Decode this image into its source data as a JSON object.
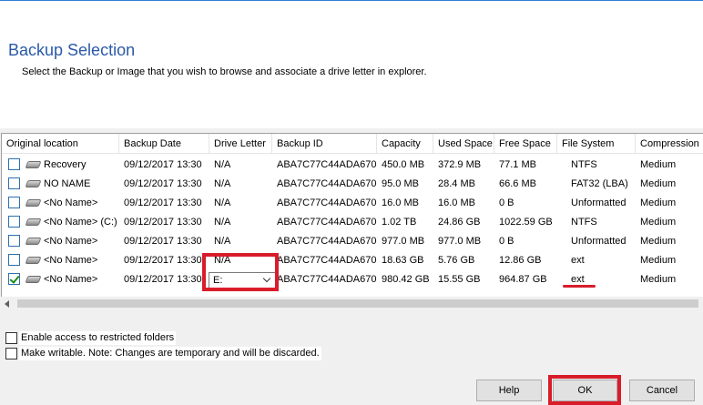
{
  "page": {
    "title": "Backup Selection",
    "subtitle": "Select the Backup or Image that you wish to browse and associate a drive letter in explorer."
  },
  "table": {
    "columns": [
      "Original location",
      "Backup Date",
      "Drive Letter",
      "Backup ID",
      "Capacity",
      "Used Space",
      "Free Space",
      "File System",
      "Compression"
    ],
    "rows": [
      {
        "checked": false,
        "location": "Recovery",
        "date": "09/12/2017 13:30",
        "drive": "N/A",
        "id": "ABA7C77C44ADA670",
        "capacity": "450.0 MB",
        "used": "372.9 MB",
        "free": "77.1 MB",
        "fs": "NTFS",
        "compression": "Medium"
      },
      {
        "checked": false,
        "location": "NO NAME",
        "date": "09/12/2017 13:30",
        "drive": "N/A",
        "id": "ABA7C77C44ADA670",
        "capacity": "95.0 MB",
        "used": "28.4 MB",
        "free": "66.6 MB",
        "fs": "FAT32 (LBA)",
        "compression": "Medium"
      },
      {
        "checked": false,
        "location": "<No Name>",
        "date": "09/12/2017 13:30",
        "drive": "N/A",
        "id": "ABA7C77C44ADA670",
        "capacity": "16.0 MB",
        "used": "16.0 MB",
        "free": "0 B",
        "fs": "Unformatted",
        "compression": "Medium"
      },
      {
        "checked": false,
        "location": "<No Name> (C:)",
        "date": "09/12/2017 13:30",
        "drive": "N/A",
        "id": "ABA7C77C44ADA670",
        "capacity": "1.02 TB",
        "used": "24.86 GB",
        "free": "1022.59 GB",
        "fs": "NTFS",
        "compression": "Medium"
      },
      {
        "checked": false,
        "location": "<No Name>",
        "date": "09/12/2017 13:30",
        "drive": "N/A",
        "id": "ABA7C77C44ADA670",
        "capacity": "977.0 MB",
        "used": "977.0 MB",
        "free": "0 B",
        "fs": "Unformatted",
        "compression": "Medium"
      },
      {
        "checked": false,
        "location": "<No Name>",
        "date": "09/12/2017 13:30",
        "drive": "N/A",
        "id": "ABA7C77C44ADA670",
        "capacity": "18.63 GB",
        "used": "5.76 GB",
        "free": "12.86 GB",
        "fs": "ext",
        "compression": "Medium"
      },
      {
        "checked": true,
        "location": "<No Name>",
        "date": "09/12/2017 13:30",
        "drive": "E:",
        "id": "ABA7C77C44ADA670",
        "capacity": "980.42 GB",
        "used": "15.55 GB",
        "free": "964.87 GB",
        "fs": "ext",
        "compression": "Medium"
      }
    ]
  },
  "options": {
    "restricted_label": "Enable access to restricted folders",
    "writable_label": "Make writable. Note: Changes are temporary and will be discarded."
  },
  "buttons": {
    "help": "Help",
    "ok": "OK",
    "cancel": "Cancel"
  },
  "colors": {
    "title": "#2a5aa8",
    "highlight": "#d81c2a",
    "check": "#1a8a1a"
  }
}
